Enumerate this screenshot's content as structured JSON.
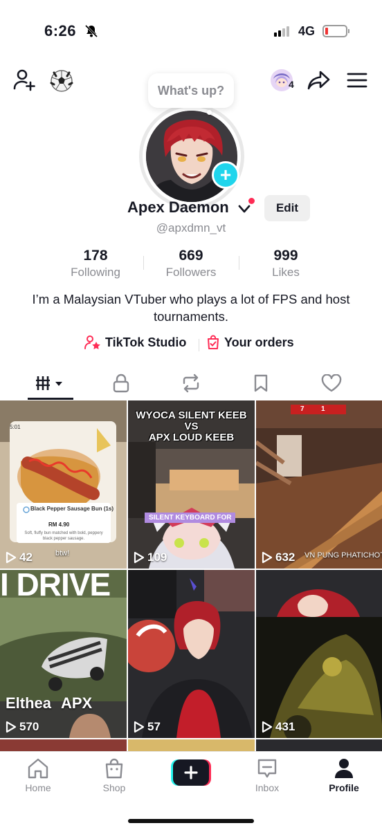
{
  "status_bar": {
    "time": "6:26",
    "network": "4G"
  },
  "bubble": {
    "text": "What's up?"
  },
  "topbar": {
    "friends_count": "4"
  },
  "profile": {
    "name": "Apex Daemon",
    "handle": "@apxdmn_vt",
    "edit_label": "Edit",
    "bio": "I’m a Malaysian VTuber who plays a lot of FPS and host tournaments."
  },
  "stats": [
    {
      "num": "178",
      "label": "Following"
    },
    {
      "num": "669",
      "label": "Followers"
    },
    {
      "num": "999",
      "label": "Likes"
    }
  ],
  "links": {
    "studio": "TikTok Studio",
    "orders": "Your orders"
  },
  "tabs": [
    "videos-icon",
    "lock-icon",
    "repost-icon",
    "bookmark-icon",
    "heart-icon"
  ],
  "videos": [
    {
      "views": "42",
      "caption": "Black Pepper Sausage Bun (1s)",
      "price": "RM 4.90",
      "desc": "Soft, fluffy bun matched with bold, peppery black pepper sausage.",
      "sticker": "btw!",
      "corner": "5:01"
    },
    {
      "views": "109",
      "title_line1": "WYOCA SILENT KEEB",
      "title_line2": "VS",
      "title_line3": "APX LOUD KEEB",
      "banner": "SILENT KEYBOARD FOR"
    },
    {
      "views": "632",
      "caption": "VN PUNG PHATICHOTI",
      "score1": "7",
      "score2": "1"
    },
    {
      "views": "570",
      "headline": "I DRIVE",
      "left_tag": "Elthea",
      "right_tag": "APX"
    },
    {
      "views": "57"
    },
    {
      "views": "431"
    }
  ],
  "bottom_nav": {
    "home": "Home",
    "shop": "Shop",
    "inbox": "Inbox",
    "profile": "Profile"
  },
  "colors": {
    "accent": "#fe2c55",
    "cyan": "#20d5ec"
  }
}
